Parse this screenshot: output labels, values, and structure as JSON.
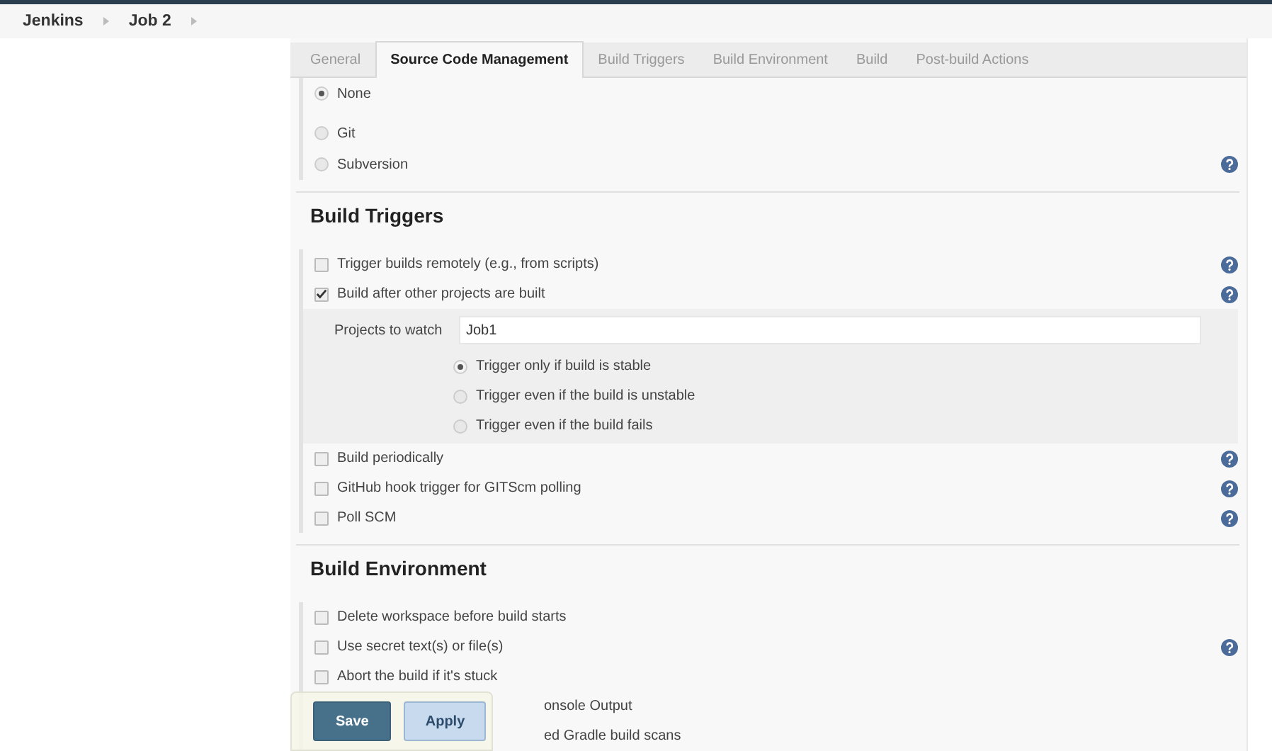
{
  "breadcrumbs": [
    {
      "label": "Jenkins"
    },
    {
      "label": "Job 2"
    }
  ],
  "tabs": [
    {
      "label": "General",
      "selected": false
    },
    {
      "label": "Source Code Management",
      "selected": true
    },
    {
      "label": "Build Triggers",
      "selected": false
    },
    {
      "label": "Build Environment",
      "selected": false
    },
    {
      "label": "Build",
      "selected": false
    },
    {
      "label": "Post-build Actions",
      "selected": false
    }
  ],
  "scm": {
    "options": [
      {
        "label": "None",
        "selected": true,
        "help": false
      },
      {
        "label": "Git",
        "selected": false,
        "help": false
      },
      {
        "label": "Subversion",
        "selected": false,
        "help": true
      }
    ]
  },
  "build_triggers": {
    "title": "Build Triggers",
    "items": [
      {
        "label": "Trigger builds remotely (e.g., from scripts)",
        "checked": false,
        "help": true
      },
      {
        "label": "Build after other projects are built",
        "checked": true,
        "help": true,
        "details": {
          "field_label": "Projects to watch",
          "field_value": "Job1",
          "options": [
            {
              "label": "Trigger only if build is stable",
              "selected": true
            },
            {
              "label": "Trigger even if the build is unstable",
              "selected": false
            },
            {
              "label": "Trigger even if the build fails",
              "selected": false
            }
          ]
        }
      },
      {
        "label": "Build periodically",
        "checked": false,
        "help": true
      },
      {
        "label": "GitHub hook trigger for GITScm polling",
        "checked": false,
        "help": true
      },
      {
        "label": "Poll SCM",
        "checked": false,
        "help": true
      }
    ]
  },
  "build_environment": {
    "title": "Build Environment",
    "items": [
      {
        "kind": "checkbox",
        "label": "Delete workspace before build starts",
        "checked": false,
        "help": false
      },
      {
        "kind": "checkbox",
        "label": "Use secret text(s) or file(s)",
        "checked": false,
        "help": true
      },
      {
        "kind": "checkbox",
        "label": "Abort the build if it's stuck",
        "checked": false,
        "help": false
      },
      {
        "kind": "partial",
        "label": "onsole Output"
      },
      {
        "kind": "partial",
        "label": "ed Gradle build scans"
      }
    ]
  },
  "actions": [
    {
      "label": "Save",
      "kind": "primary"
    },
    {
      "label": "Apply",
      "kind": "secondary"
    }
  ]
}
